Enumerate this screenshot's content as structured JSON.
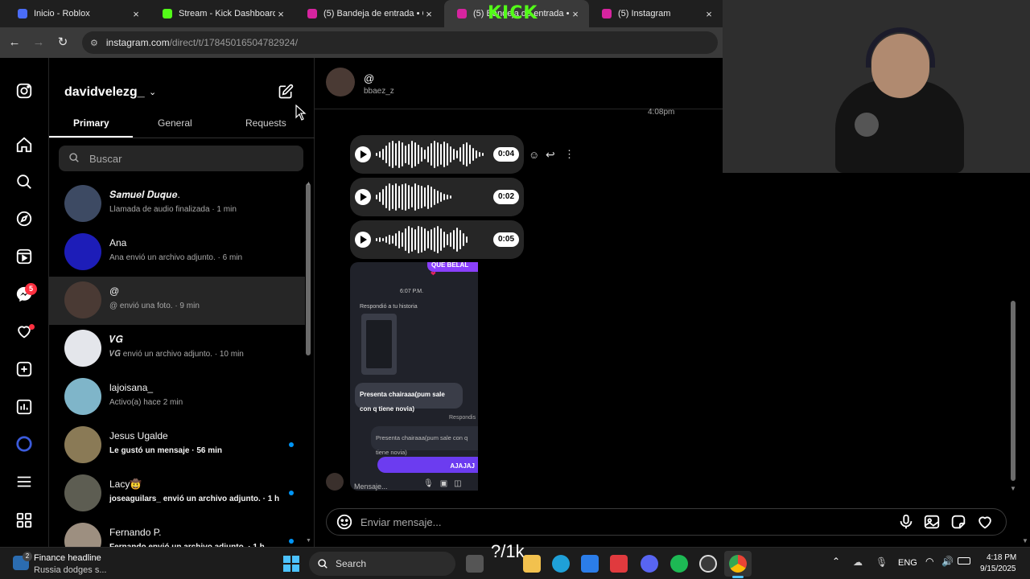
{
  "browser": {
    "tabs": [
      {
        "title": "Inicio - Roblox",
        "color": "#4a6cf7"
      },
      {
        "title": "Stream - Kick Dashboard",
        "color": "#53fc18"
      },
      {
        "title": "(5) Bandeja de entrada • Ch",
        "color": "#d6249f"
      },
      {
        "title": "(5) Bandeja de entrada • Ch",
        "color": "#d6249f"
      },
      {
        "title": "(5) Instagram",
        "color": "#d6249f"
      }
    ],
    "tab_close": "×",
    "overlay_logo": "KICK",
    "url_host": "instagram.com",
    "url_path": "/direct/t/17845016504782924/"
  },
  "rail": {
    "badge_count": "5",
    "icons": [
      "instagram-icon",
      "home-icon",
      "search-icon",
      "explore-icon",
      "reels-icon",
      "messenger-icon",
      "heart-icon",
      "create-icon",
      "dashboard-icon",
      "meta-ai-icon",
      "menu-icon",
      "threads-icon"
    ]
  },
  "list": {
    "username": "davidvelezg_",
    "tabs": [
      "Primary",
      "General",
      "Requests"
    ],
    "search_placeholder": "Buscar",
    "conversations": [
      {
        "name": "𝑺𝒂𝒎𝒖𝒆𝒍 𝑫𝒖𝒒𝒖𝒆.",
        "preview": "Llamada de audio finalizada · 1 min",
        "bold": false,
        "unread": false,
        "avatar": "#3d4a63"
      },
      {
        "name": "Ana",
        "preview": "Ana envió un archivo adjunto. · 6 min",
        "bold": false,
        "unread": false,
        "avatar": "#1d1db8"
      },
      {
        "name": "@",
        "preview": "@ envió una foto. · 9 min",
        "bold": false,
        "unread": false,
        "avatar": "#4a3a34"
      },
      {
        "name": "𝑽𝑮",
        "preview": "𝑽𝑮 envió un archivo adjunto. · 10 min",
        "bold": false,
        "unread": false,
        "avatar": "#e4e6eb"
      },
      {
        "name": "lajoisana_",
        "preview": "Activo(a) hace 2 min",
        "bold": false,
        "unread": false,
        "avatar": "#7fb5c9"
      },
      {
        "name": "Jesus Ugalde",
        "preview": "Le gustó un mensaje · 56 min",
        "bold": true,
        "unread": true,
        "avatar": "#8a7a56"
      },
      {
        "name": "Lacy🤠",
        "preview": "joseaguilars_ envió un archivo adjunto. · 1 h",
        "bold": true,
        "unread": true,
        "avatar": "#5d5d52"
      },
      {
        "name": "Fernando P.",
        "preview": "Fernando envió un archivo adjunto. · 1 h",
        "bold": true,
        "unread": true,
        "avatar": "#9d8f80"
      }
    ]
  },
  "chat": {
    "header_name": "@",
    "header_handle": "bbaez_z",
    "timestamp": "4:08pm",
    "voice_notes": [
      {
        "duration": "0:04"
      },
      {
        "duration": "0:02"
      },
      {
        "duration": "0:05"
      }
    ],
    "screenshot": {
      "top_bubble": "QUE BELAL",
      "time": "6:07 P.M.",
      "replied_label": "Respondió a tu historia",
      "message": "Presenta chairaaa(pum sale con q tiene novia)",
      "reply_label": "Respondis",
      "quoted": "Presenta chairaaa(pum sale con q tiene novia)",
      "reply_bubble": "AJAJAJ",
      "composer": "Mensaje..."
    },
    "composer_placeholder": "Enviar mensaje..."
  },
  "taskbar": {
    "news_badge": "2",
    "news_title": "Finance headline",
    "news_subtitle": "Russia dodges s...",
    "search_label": "Search",
    "overlay_text": "?/1k",
    "lang": "ENG",
    "time": "4:18 PM",
    "date": "9/15/2025"
  }
}
